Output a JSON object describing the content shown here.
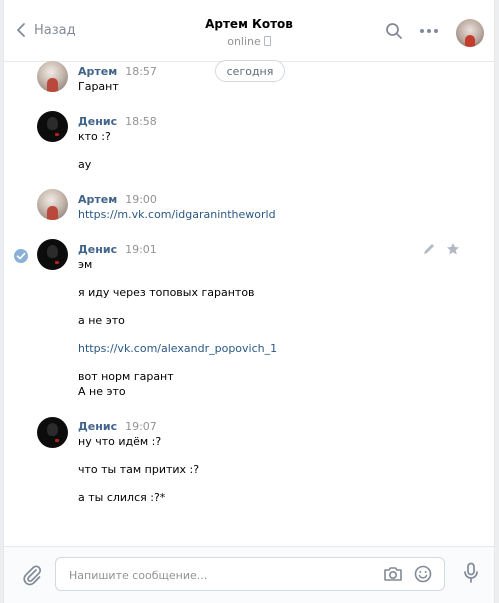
{
  "header": {
    "back_label": "Назад",
    "contact_name": "Артем Котов",
    "status": "online"
  },
  "date_divider": "сегодня",
  "messages": [
    {
      "author": "Артем",
      "time": "18:57",
      "lines": [
        "Гарант"
      ]
    },
    {
      "author": "Денис",
      "time": "18:58",
      "lines": [
        "кто :?",
        "ау"
      ]
    },
    {
      "author": "Артем",
      "time": "19:00",
      "lines": [
        "https://m.vk.com/idgaranintheworld"
      ]
    },
    {
      "author": "Денис",
      "time": "19:01",
      "lines": [
        "эм",
        "я иду через топовых гарантов",
        "а не это",
        "https://vk.com/alexandr_popovich_1",
        "вот норм гарант",
        "А не это"
      ]
    },
    {
      "author": "Денис",
      "time": "19:07",
      "lines": [
        "ну что идём :?",
        "что ты там притих :?",
        "а ты слился :?*"
      ]
    }
  ],
  "composer": {
    "placeholder": "Напишите сообщение..."
  },
  "colors": {
    "author": "#42648b",
    "link": "#2a5885",
    "muted": "#939393",
    "icon": "#828a99"
  },
  "icons": [
    "back-chevron-icon",
    "search-icon",
    "more-icon",
    "phone-icon",
    "check-icon",
    "edit-icon",
    "star-icon",
    "attach-icon",
    "camera-icon",
    "smile-icon",
    "microphone-icon"
  ]
}
